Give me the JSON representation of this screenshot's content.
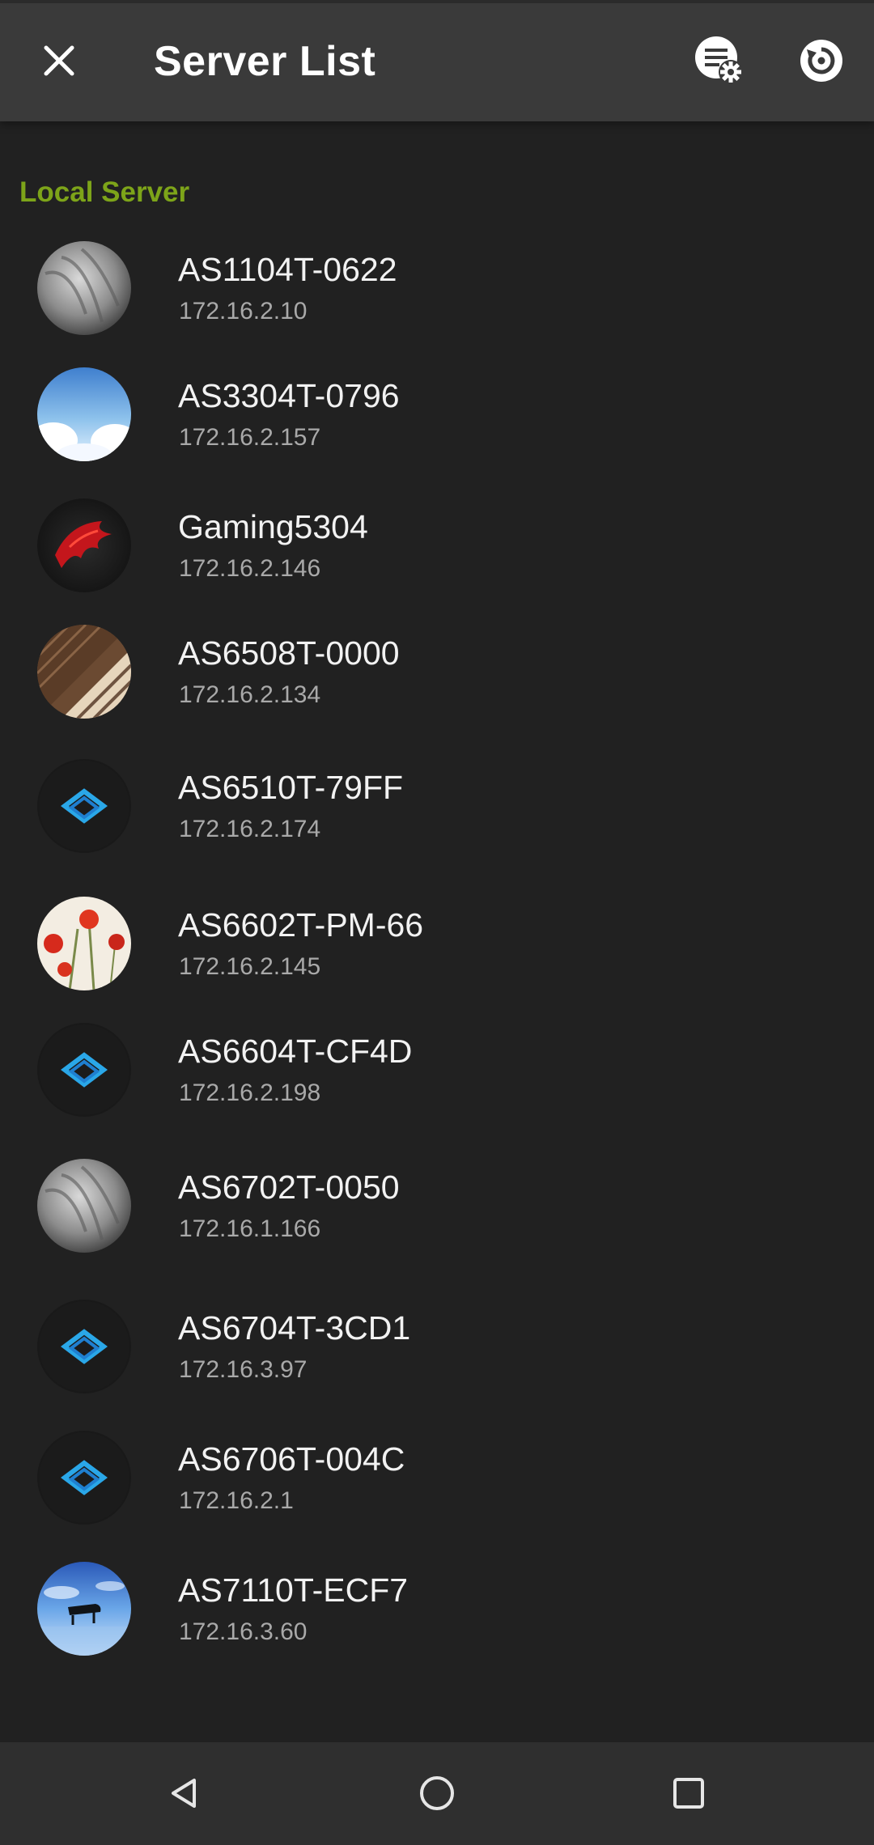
{
  "header": {
    "title": "Server List",
    "close_icon": "close-icon",
    "settings_icon": "list-settings-icon",
    "refresh_icon": "refresh-icon"
  },
  "section": {
    "title": "Local Server",
    "color": "#7da419"
  },
  "servers": [
    {
      "name": "AS1104T-0622",
      "ip": "172.16.2.10",
      "avatar": "gray-texture-avatar"
    },
    {
      "name": "AS3304T-0796",
      "ip": "172.16.2.157",
      "avatar": "sky-clouds-avatar"
    },
    {
      "name": "Gaming5304",
      "ip": "172.16.2.146",
      "avatar": "red-dragon-avatar"
    },
    {
      "name": "AS6508T-0000",
      "ip": "172.16.2.134",
      "avatar": "wood-stripes-avatar"
    },
    {
      "name": "AS6510T-79FF",
      "ip": "172.16.2.174",
      "avatar": "blue-logo-avatar"
    },
    {
      "name": "AS6602T-PM-66",
      "ip": "172.16.2.145",
      "avatar": "poppy-flowers-avatar"
    },
    {
      "name": "AS6604T-CF4D",
      "ip": "172.16.2.198",
      "avatar": "blue-logo-avatar"
    },
    {
      "name": "AS6702T-0050",
      "ip": "172.16.1.166",
      "avatar": "gray-texture-avatar"
    },
    {
      "name": "AS6704T-3CD1",
      "ip": "172.16.3.97",
      "avatar": "blue-logo-avatar"
    },
    {
      "name": "AS6706T-004C",
      "ip": "172.16.2.1",
      "avatar": "blue-logo-avatar"
    },
    {
      "name": "AS7110T-ECF7",
      "ip": "172.16.3.60",
      "avatar": "piano-sky-avatar"
    }
  ],
  "navbar": {
    "back_icon": "back-triangle-icon",
    "home_icon": "home-circle-icon",
    "recents_icon": "recents-square-icon"
  }
}
